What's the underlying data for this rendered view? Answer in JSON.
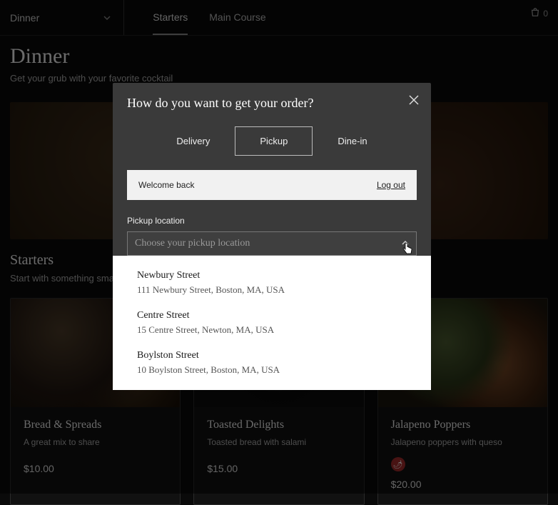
{
  "topbar": {
    "menu_label": "Dinner",
    "tabs": [
      {
        "label": "Starters",
        "active": true
      },
      {
        "label": "Main Course",
        "active": false
      }
    ],
    "cart_count": "0"
  },
  "header": {
    "title": "Dinner",
    "subtitle": "Get your grub with your favorite cocktail"
  },
  "section": {
    "title": "Starters",
    "subtitle": "Start with something small"
  },
  "cards": [
    {
      "name": "Bread & Spreads",
      "desc": "A great mix to share",
      "price": "$10.00",
      "spicy": false
    },
    {
      "name": "Toasted Delights",
      "desc": "Toasted bread with salami",
      "price": "$15.00",
      "spicy": false
    },
    {
      "name": "Jalapeno Poppers",
      "desc": "Jalapeno poppers with queso",
      "price": "$20.00",
      "spicy": true
    }
  ],
  "modal": {
    "title": "How do you want to get your order?",
    "methods": {
      "delivery": "Delivery",
      "pickup": "Pickup",
      "dinein": "Dine-in",
      "active": "pickup"
    },
    "welcome": {
      "text": "Welcome back",
      "logout": "Log out"
    },
    "location": {
      "label": "Pickup location",
      "placeholder": "Choose your pickup location",
      "options": [
        {
          "name": "Newbury Street",
          "address": "111 Newbury Street, Boston, MA, USA"
        },
        {
          "name": "Centre Street",
          "address": "15 Centre Street, Newton, MA, USA"
        },
        {
          "name": "Boylston Street",
          "address": "10 Boylston Street, Boston, MA, USA"
        }
      ]
    }
  }
}
